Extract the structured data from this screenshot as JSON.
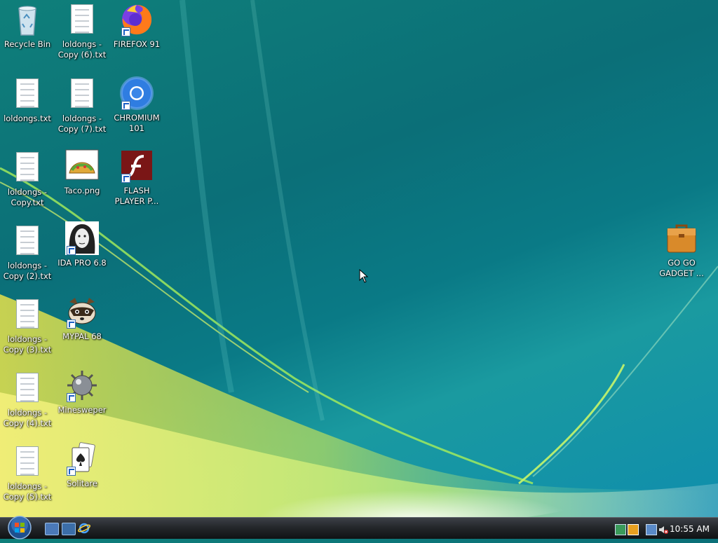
{
  "desktop": {
    "col1": [
      {
        "label": "Recycle Bin",
        "icon": "recycle-bin-icon"
      },
      {
        "label": "loldongs.txt",
        "icon": "text-file-icon"
      },
      {
        "label": "loldongs -\nCopy.txt",
        "icon": "text-file-icon"
      },
      {
        "label": "loldongs -\nCopy (2).txt",
        "icon": "text-file-icon"
      },
      {
        "label": "loldongs -\nCopy (3).txt",
        "icon": "text-file-icon"
      },
      {
        "label": "loldongs -\nCopy (4).txt",
        "icon": "text-file-icon"
      },
      {
        "label": "loldongs -\nCopy (5).txt",
        "icon": "text-file-icon"
      }
    ],
    "col2": [
      {
        "label": "loldongs -\nCopy (6).txt",
        "icon": "text-file-icon"
      },
      {
        "label": "loldongs -\nCopy (7).txt",
        "icon": "text-file-icon"
      },
      {
        "label": "Taco.png",
        "icon": "taco-image-icon"
      },
      {
        "label": "IDA PRO 6.8",
        "icon": "ida-pro-icon"
      },
      {
        "label": "MYPAL 68",
        "icon": "mypal-raccoon-icon"
      },
      {
        "label": "Minesweper",
        "icon": "minesweeper-mine-icon"
      },
      {
        "label": "Solitare",
        "icon": "solitaire-cards-icon"
      }
    ],
    "col3": [
      {
        "label": "FIREFOX 91",
        "icon": "firefox-icon"
      },
      {
        "label": "CHROMIUM\n101",
        "icon": "chromium-icon"
      },
      {
        "label": "FLASH\nPLAYER P...",
        "icon": "flash-player-icon"
      }
    ],
    "right": [
      {
        "label": "GO GO\nGADGET ...",
        "icon": "briefcase-icon"
      }
    ]
  },
  "taskbar": {
    "clock": "10:55 AM"
  },
  "colors": {
    "taskbar": "#24272b",
    "wallpaper_teal": "#0f7f7a",
    "accent_green": "#8be04a"
  }
}
